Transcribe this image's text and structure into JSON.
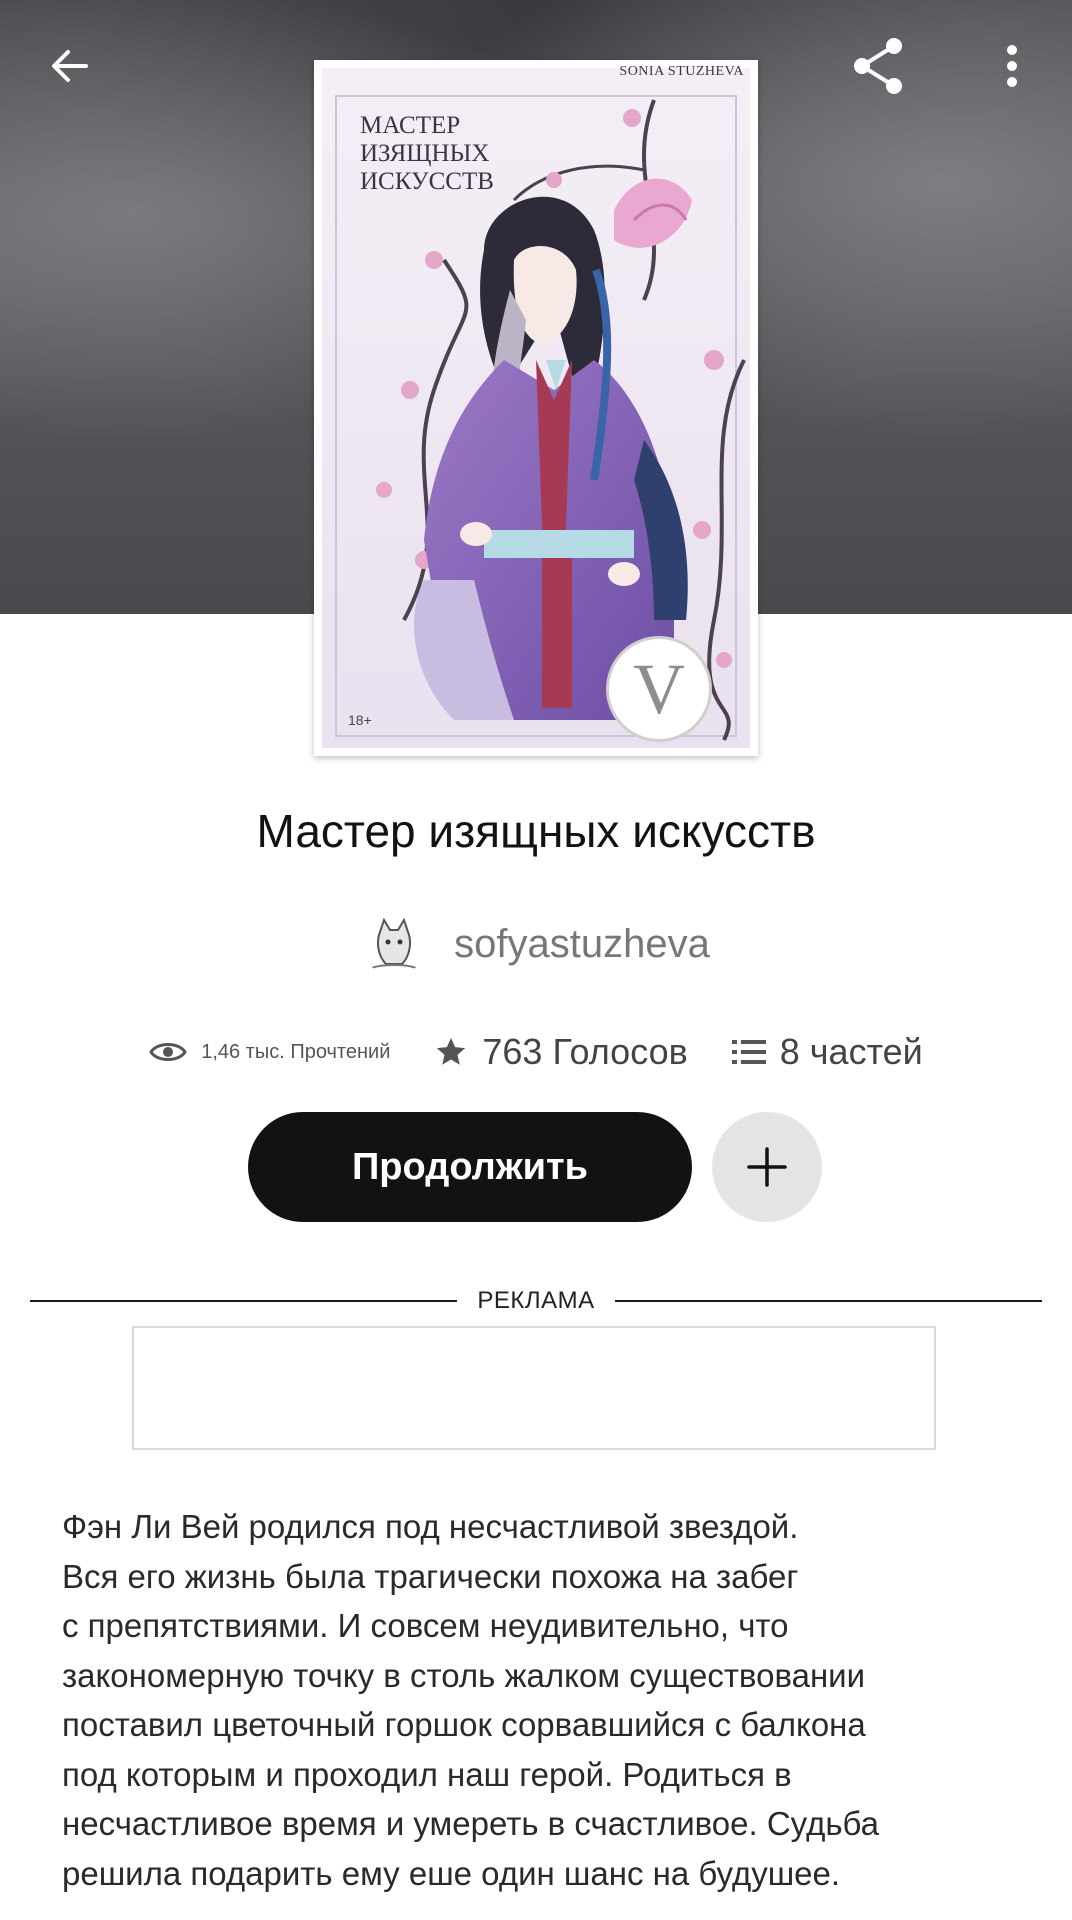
{
  "header": {
    "back_icon": "arrow-left-icon",
    "share_icon": "share-icon",
    "menu_icon": "more-vertical-icon"
  },
  "cover": {
    "author_text": "SONIA STUZHEVA",
    "title_text": "МАСТЕР\nИЗЯЩНЫХ\nИСКУССТВ",
    "age_rating": "18+",
    "badge_letter": "V"
  },
  "book": {
    "title": "Мастер изящных искусств",
    "author": "sofyastuzheva"
  },
  "stats": {
    "reads": "1,46 тыс. Прочтений",
    "votes": "763 Голосов",
    "parts": "8 частей"
  },
  "actions": {
    "continue_label": "Продолжить",
    "add_icon": "plus-icon"
  },
  "ad": {
    "label": "РЕКЛАМА"
  },
  "description": "Фэн Ли Вей родился под несчастливой звездой.\nВся его жизнь была трагически похожа на забег\nс препятствиями. И совсем неудивительно, что\nзакономерную точку в столь жалком существовании\nпоставил цветочный горшок сорвавшийся с балкона\nпод которым и проходил наш герой. Родиться в\nнесчастливое время и умереть в счастливое. Судьба\nрешила подарить ему еше один шанс на будушее.",
  "colors": {
    "primary_button": "#121212",
    "secondary_button": "#e4e4e6",
    "hero_background": "#4f4e53"
  }
}
